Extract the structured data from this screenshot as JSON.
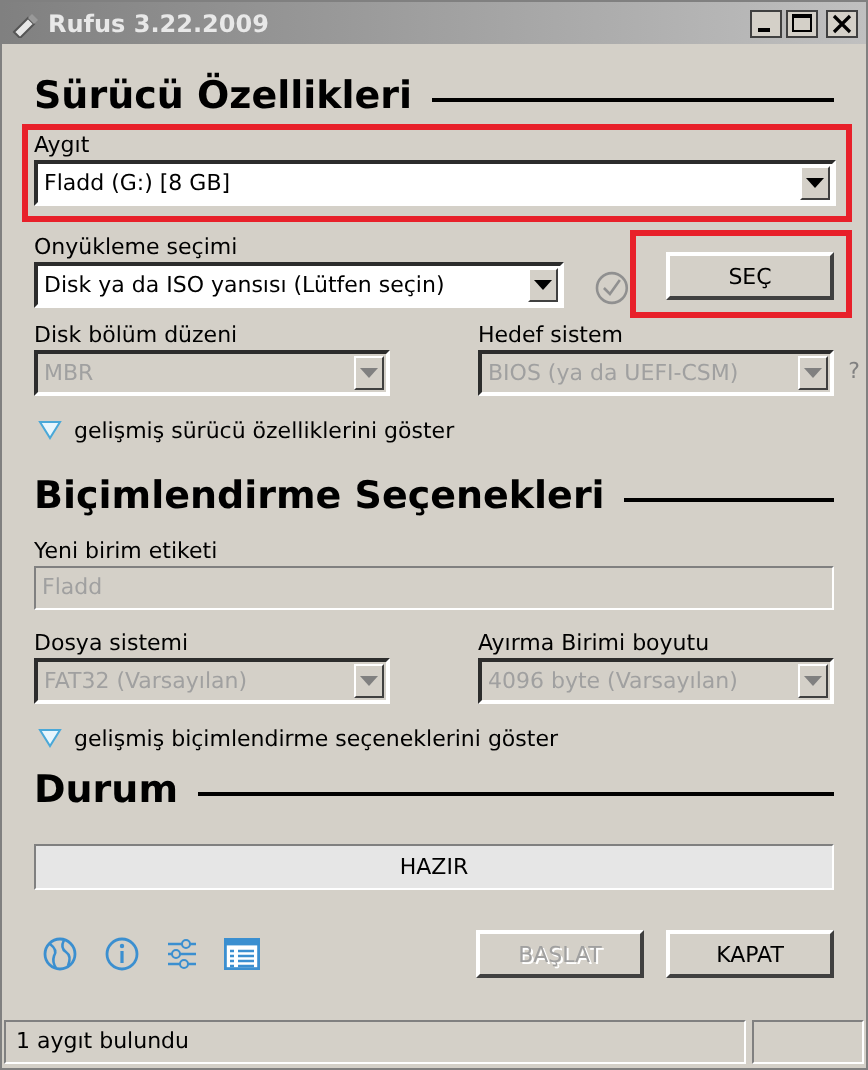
{
  "window": {
    "title": "Rufus 3.22.2009"
  },
  "drive_properties": {
    "title": "Sürücü Özellikleri",
    "device": {
      "label": "Aygıt",
      "value": "Fladd (G:) [8 GB]",
      "disabled": false,
      "highlighted": true
    },
    "boot_selection": {
      "label": "Onyükleme seçimi",
      "value": "Disk ya da ISO yansısı (Lütfen seçin)",
      "disabled": false
    },
    "select_button": {
      "label": "SEÇ",
      "highlighted": true
    },
    "partition_scheme": {
      "label": "Disk bölüm düzeni",
      "value": "MBR",
      "disabled": true
    },
    "target_system": {
      "label": "Hedef sistem",
      "value": "BIOS (ya da UEFI-CSM)",
      "disabled": true
    },
    "help": "?",
    "advanced_toggle": {
      "label": "gelişmiş sürücü özelliklerini göster",
      "expanded": false
    }
  },
  "format_options": {
    "title": "Biçimlendirme Seçenekleri",
    "volume_label": {
      "label": "Yeni birim etiketi",
      "value": "Fladd",
      "disabled": true
    },
    "file_system": {
      "label": "Dosya sistemi",
      "value": "FAT32 (Varsayılan)",
      "disabled": true
    },
    "cluster_size": {
      "label": "Ayırma Birimi boyutu",
      "value": "4096 byte (Varsayılan)",
      "disabled": true
    },
    "advanced_toggle": {
      "label": "gelişmiş biçimlendirme seçeneklerini göster",
      "expanded": false
    }
  },
  "status": {
    "title": "Durum",
    "progress": {
      "text": "HAZIR"
    },
    "start_button": {
      "label": "BAŞLAT",
      "disabled": true
    },
    "close_button": {
      "label": "KAPAT",
      "disabled": false
    }
  },
  "status_bar": {
    "text": "1 aygıt bulundu"
  }
}
